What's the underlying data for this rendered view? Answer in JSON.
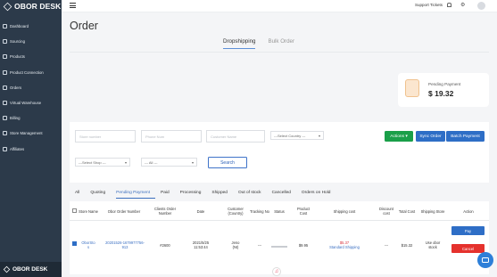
{
  "brand": "OBOR DESK",
  "sidebar": {
    "items": [
      {
        "label": "Dashboard"
      },
      {
        "label": "Sourcing"
      },
      {
        "label": "Products"
      },
      {
        "label": "Product Connection"
      },
      {
        "label": "Orders"
      },
      {
        "label": "Virtual Warehouse"
      },
      {
        "label": "Billing"
      },
      {
        "label": "Store Management"
      },
      {
        "label": "Affiliates"
      }
    ],
    "footer": "OBOR DESK"
  },
  "header": {
    "support": "Support Tickets"
  },
  "page": {
    "title": "Order",
    "tabs": [
      "Dropshipping",
      "Bulk Order"
    ],
    "active_tab": "Dropshipping"
  },
  "pending": {
    "label": "Pending Payment",
    "value": "$ 19.32"
  },
  "filters": {
    "store_number_placeholder": "Store number",
    "phone_placeholder": "Phone Num",
    "customer_name_placeholder": "Customer Name",
    "country": "---Select Country ---",
    "shop": "---Select Shop ---",
    "all": "--- All ---",
    "actions": "Actions",
    "sync_order": "Sync Order",
    "batch_payment": "Batch Payment",
    "search": "Search"
  },
  "status_tabs": [
    "All",
    "Quoting",
    "Pending Payment",
    "Paid",
    "Processing",
    "Shipped",
    "Out of stock",
    "Cancelled",
    "Orders on Hold"
  ],
  "active_status": "Pending Payment",
  "table": {
    "headers": [
      "Store Name",
      "Obor Order Number",
      "Clients Order Number",
      "Date",
      "Customer (Country)",
      "Tracking No",
      "Status",
      "Product Cost",
      "Shipping cost",
      "Discount cost",
      "Total Cost",
      "Shipping Store",
      "Action"
    ],
    "row": {
      "store": [
        "OborSto",
        "s"
      ],
      "order_number": [
        "20201526-1679977756-",
        "913"
      ],
      "client_order": "#2600",
      "date": [
        "2021/5/25",
        "11:53:44"
      ],
      "customer": [
        "Jeno",
        "(NI)"
      ],
      "tracking": "---",
      "product_cost": "$9.95",
      "shipping_cost": "$5.37",
      "shipping_method": "Standard Shipping",
      "discount": "---",
      "total": "$15.32",
      "shipping_store": [
        "Use obor",
        "stock"
      ],
      "pay": "Pay",
      "cancel": "Cancel"
    }
  },
  "colors": {
    "sidebar": "#2c3a4a",
    "primary": "#2e6ec6",
    "success": "#1a9f49",
    "danger": "#e5322d"
  }
}
